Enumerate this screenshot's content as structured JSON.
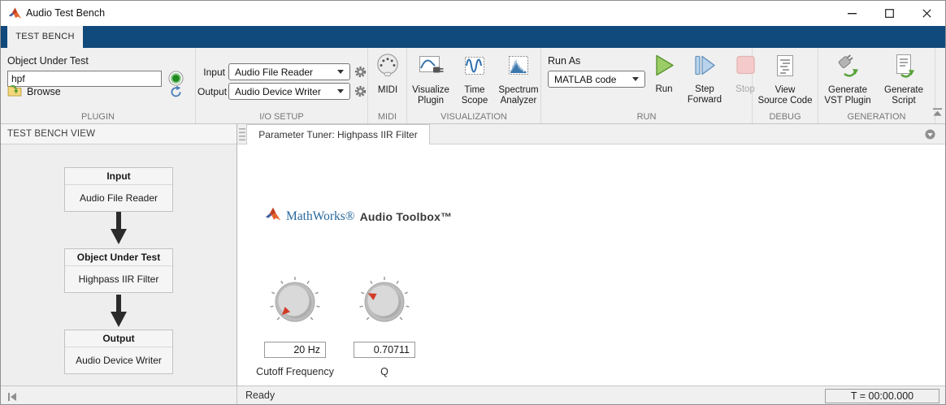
{
  "window": {
    "title": "Audio Test Bench"
  },
  "ribbon": {
    "tab": "TEST BENCH"
  },
  "toolbar": {
    "plugin": {
      "field_label": "Object Under Test",
      "field_value": "hpf",
      "browse": "Browse",
      "section": "PLUGIN"
    },
    "io_setup": {
      "input_label": "Input",
      "input_value": "Audio File Reader",
      "output_label": "Output",
      "output_value": "Audio Device Writer",
      "section": "I/O SETUP"
    },
    "midi": {
      "label": "MIDI",
      "section": "MIDI"
    },
    "visualization": {
      "visualize_plugin": [
        "Visualize",
        "Plugin"
      ],
      "time_scope": [
        "Time",
        "Scope"
      ],
      "spectrum_analyzer": [
        "Spectrum",
        "Analyzer"
      ],
      "section": "VISUALIZATION"
    },
    "run": {
      "run_as_label": "Run As",
      "run_as_value": "MATLAB code",
      "run_label": "Run",
      "step_label": [
        "Step",
        "Forward"
      ],
      "stop_label": "Stop",
      "section": "RUN"
    },
    "debug": {
      "view_source": [
        "View",
        "Source Code"
      ],
      "section": "DEBUG"
    },
    "generation": {
      "vst": [
        "Generate",
        "VST Plugin"
      ],
      "script": [
        "Generate",
        "Script"
      ],
      "section": "GENERATION"
    }
  },
  "left_panel": {
    "title": "TEST BENCH VIEW",
    "blocks": [
      {
        "header": "Input",
        "body": "Audio File Reader"
      },
      {
        "header": "Object Under Test",
        "body": "Highpass IIR Filter"
      },
      {
        "header": "Output",
        "body": "Audio Device Writer"
      }
    ]
  },
  "main_panel": {
    "tab": "Parameter Tuner: Highpass IIR Filter",
    "brand": {
      "name": "MathWorks®",
      "product": "Audio Toolbox™"
    },
    "knobs": [
      {
        "value": "20 Hz",
        "label": "Cutoff Frequency"
      },
      {
        "value": "0.70711",
        "label": "Q"
      }
    ]
  },
  "status_bar": {
    "status": "Ready",
    "timer": "T = 00:00.000"
  },
  "colors": {
    "toolstrip_blue": "#10497c",
    "run_green": "#9ccc65",
    "step_blue": "#b8d4ec",
    "stop_pink": "#f4caca",
    "indicator_green": "#1e8a1e",
    "mathworks_blue": "#26689e",
    "knob_pointer_red": "#d23b28"
  }
}
